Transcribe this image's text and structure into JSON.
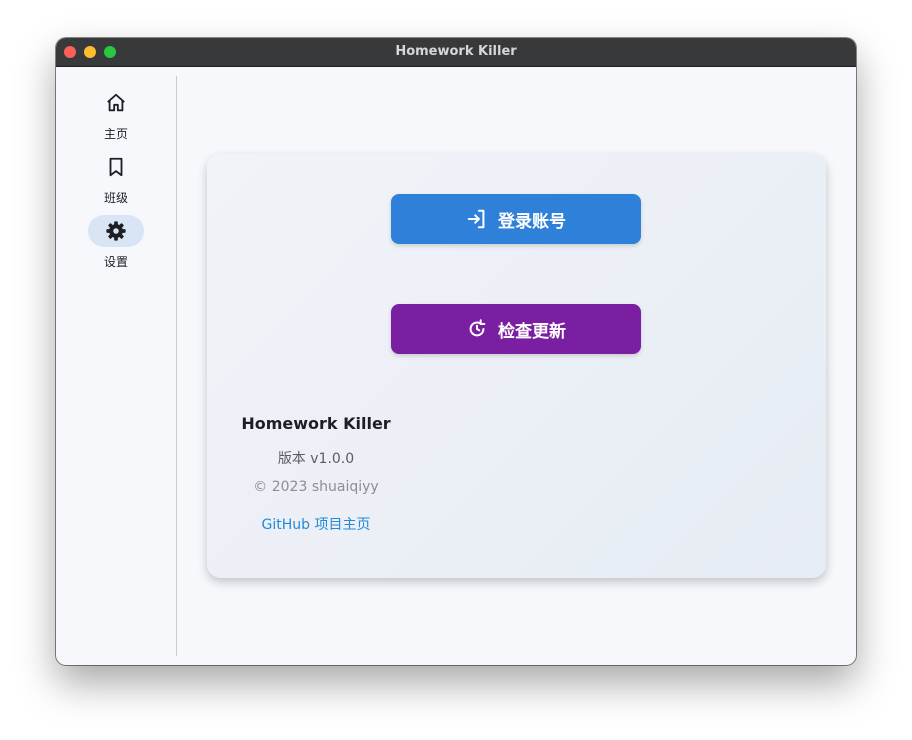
{
  "window": {
    "title": "Homework Killer"
  },
  "sidebar": {
    "items": [
      {
        "label": "主页",
        "icon": "home-icon",
        "active": false
      },
      {
        "label": "班级",
        "icon": "bookmark-icon",
        "active": false
      },
      {
        "label": "设置",
        "icon": "gear-icon",
        "active": true
      }
    ]
  },
  "actions": {
    "login_label": "登录账号",
    "login_icon": "login-icon",
    "login_color": "#2f80d9",
    "update_label": "检查更新",
    "update_icon": "refresh-icon",
    "update_color": "#7b1fa2"
  },
  "about": {
    "app_name": "Homework Killer",
    "version": "版本 v1.0.0",
    "copyright": "© 2023 shuaiqiyy",
    "github_link": "GitHub 项目主页"
  },
  "colors": {
    "accent": "#2f80d9",
    "link": "#1f8ad8",
    "active_nav_bg": "#d9e4f5"
  }
}
